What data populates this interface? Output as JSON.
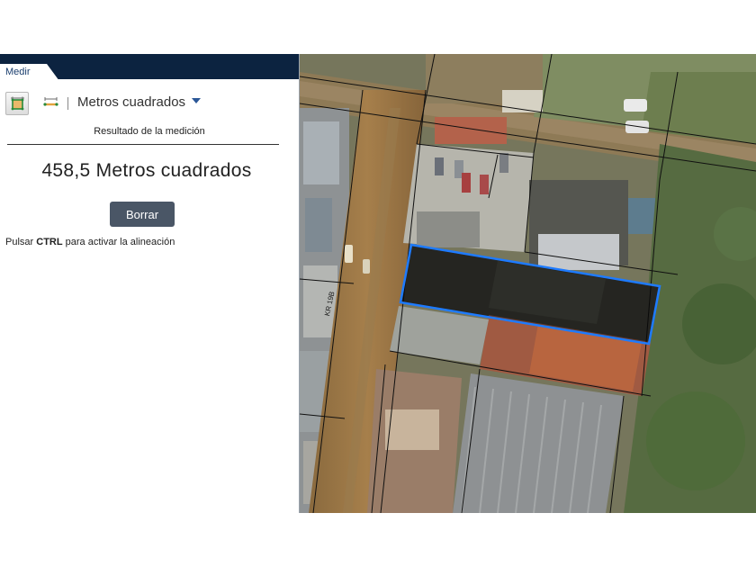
{
  "panel": {
    "tab_label": "Medir",
    "tools": {
      "area_icon": "area-measure-icon",
      "distance_icon": "distance-measure-icon"
    },
    "unit_selected": "Metros cuadrados",
    "result_label": "Resultado de la medición",
    "result_value": "458,5 Metros cuadrados",
    "clear_label": "Borrar",
    "hint_prefix": "Pulsar ",
    "hint_key": "CTRL",
    "hint_suffix": " para activar la alineación"
  },
  "map": {
    "road_label": "KR 19B",
    "highlight_color": "#1e7bff"
  },
  "colors": {
    "tab_bar": "#0c2340",
    "clear_button": "#4a5666",
    "caret": "#2b5797"
  }
}
